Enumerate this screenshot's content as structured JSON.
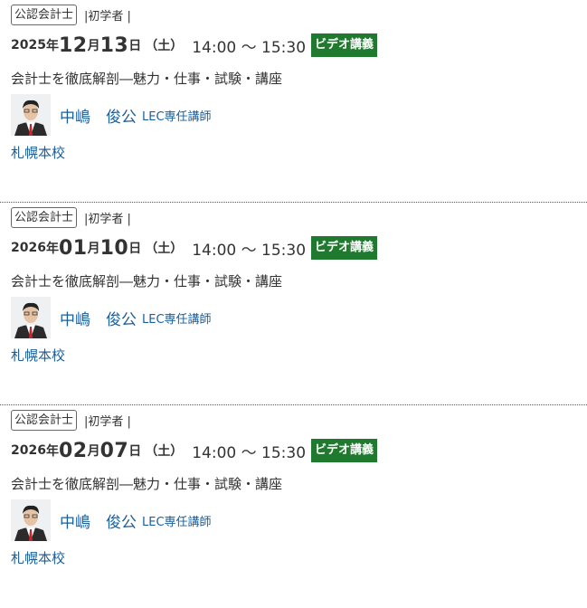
{
  "events": [
    {
      "category": "公認会計士",
      "level": "|初学者 |",
      "year": "2025",
      "year_unit": "年",
      "month": "12",
      "month_unit": "月",
      "day": "13",
      "day_unit": "日",
      "weekday": "（土）",
      "time": "14:00 ～ 15:30",
      "badge": "ビデオ講義",
      "title": "会計士を徹底解剖―魅力・仕事・試験・講座",
      "teacher_name": "中嶋　俊公",
      "teacher_role": "LEC専任講師",
      "school": "札幌本校"
    },
    {
      "category": "公認会計士",
      "level": "|初学者 |",
      "year": "2026",
      "year_unit": "年",
      "month": "01",
      "month_unit": "月",
      "day": "10",
      "day_unit": "日",
      "weekday": "（土）",
      "time": "14:00 ～ 15:30",
      "badge": "ビデオ講義",
      "title": "会計士を徹底解剖―魅力・仕事・試験・講座",
      "teacher_name": "中嶋　俊公",
      "teacher_role": "LEC専任講師",
      "school": "札幌本校"
    },
    {
      "category": "公認会計士",
      "level": "|初学者 |",
      "year": "2026",
      "year_unit": "年",
      "month": "02",
      "month_unit": "月",
      "day": "07",
      "day_unit": "日",
      "weekday": "（土）",
      "time": "14:00 ～ 15:30",
      "badge": "ビデオ講義",
      "title": "会計士を徹底解剖―魅力・仕事・試験・講座",
      "teacher_name": "中嶋　俊公",
      "teacher_role": "LEC専任講師",
      "school": "札幌本校"
    }
  ],
  "colors": {
    "badge_bg": "#1f7a2f",
    "link": "#1a5e9a",
    "text": "#333333"
  },
  "icons": {
    "avatar": "teacher-photo"
  }
}
